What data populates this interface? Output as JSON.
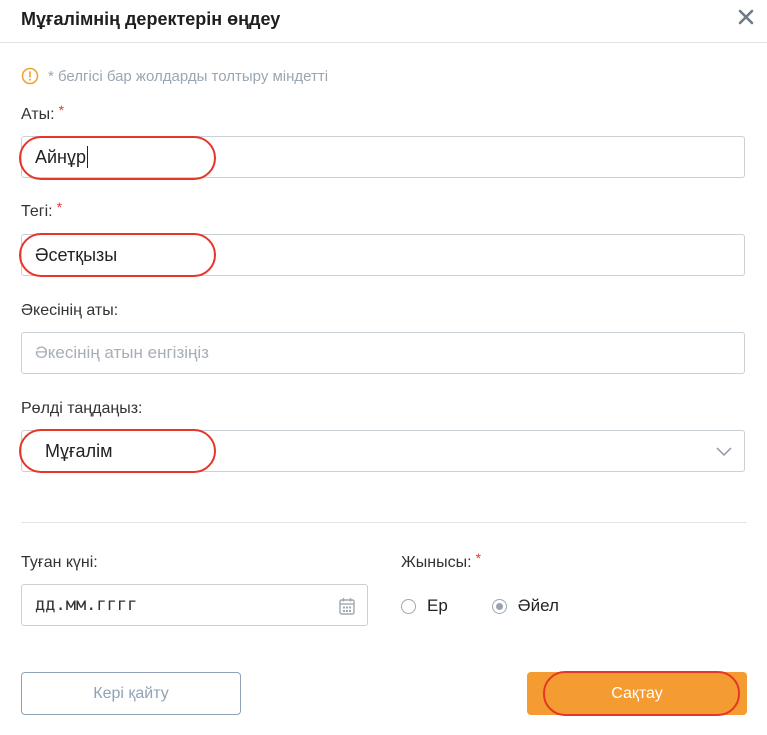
{
  "dialog": {
    "title": "Мұғалімнің деректерін өңдеу"
  },
  "note": {
    "text": "* белгісі бар жолдарды толтыру міндетті"
  },
  "fields": {
    "first_name": {
      "label": "Аты:",
      "required_mark": "*",
      "value": "Айнұр"
    },
    "last_name": {
      "label": "Тегі:",
      "required_mark": "*",
      "value": "Әсетқызы"
    },
    "patronymic": {
      "label": "Әкесінің аты:",
      "placeholder": "Әкесінің атын енгізіңіз"
    },
    "role": {
      "label": "Рөлді таңдаңыз:",
      "value": "Мұғалім"
    },
    "birth_date": {
      "label": "Туған күні:",
      "placeholder": "дд.мм.гггг"
    },
    "gender": {
      "label": "Жынысы:",
      "required_mark": "*",
      "options": [
        {
          "label": "Ер",
          "checked": false
        },
        {
          "label": "Әйел",
          "checked": true
        }
      ]
    }
  },
  "buttons": {
    "back": "Кері қайту",
    "save": "Сақтау"
  },
  "colors": {
    "accent": "#f49b32",
    "required": "#e53935",
    "highlight": "#e5362a",
    "warning_icon": "#f0a030"
  }
}
